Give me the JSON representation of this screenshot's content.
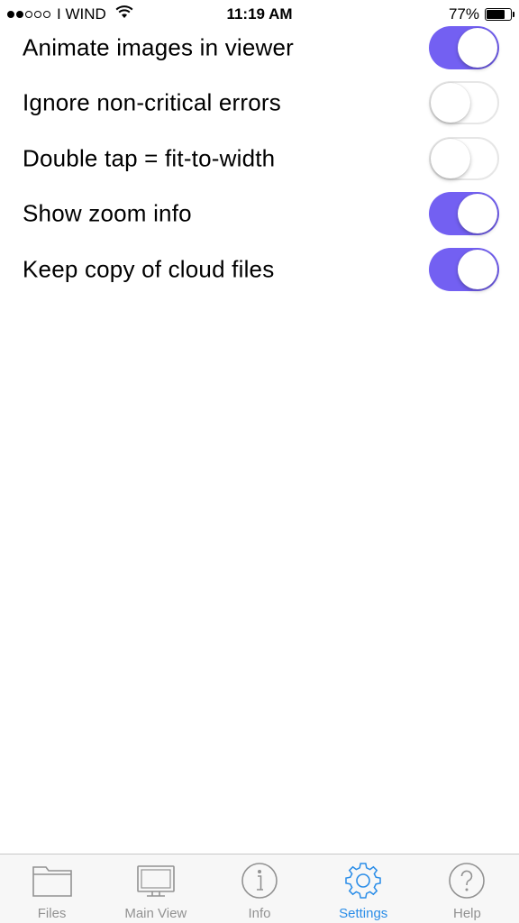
{
  "status_bar": {
    "signal_filled": 2,
    "signal_total": 5,
    "carrier": "I WIND",
    "time": "11:19 AM",
    "battery_percent": "77%",
    "battery_level": 0.77
  },
  "settings": [
    {
      "label": "Animate images in viewer",
      "enabled": true
    },
    {
      "label": "Ignore non-critical errors",
      "enabled": false
    },
    {
      "label": "Double tap = fit-to-width",
      "enabled": false
    },
    {
      "label": "Show zoom info",
      "enabled": true
    },
    {
      "label": "Keep copy of cloud files",
      "enabled": true
    }
  ],
  "colors": {
    "switch_on": "#7360f2",
    "tab_active": "#2a8de8",
    "tab_inactive": "#929292"
  },
  "tab_bar": {
    "tabs": [
      {
        "label": "Files",
        "icon": "folder-icon",
        "active": false
      },
      {
        "label": "Main View",
        "icon": "monitor-icon",
        "active": false
      },
      {
        "label": "Info",
        "icon": "info-icon",
        "active": false
      },
      {
        "label": "Settings",
        "icon": "gear-icon",
        "active": true
      },
      {
        "label": "Help",
        "icon": "help-icon",
        "active": false
      }
    ]
  }
}
